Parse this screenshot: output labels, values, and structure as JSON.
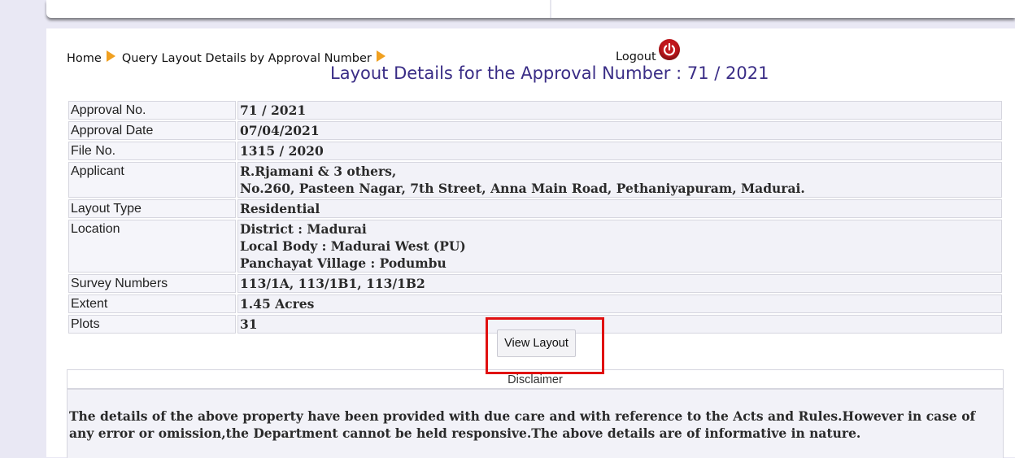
{
  "breadcrumb": {
    "home": "Home",
    "query": "Query Layout Details by Approval Number"
  },
  "logout_label": "Logout",
  "page_title": "Layout Details for the Approval Number : 71 / 2021",
  "details": {
    "approval_no": {
      "label": "Approval No.",
      "value": "71 / 2021"
    },
    "approval_date": {
      "label": "Approval Date",
      "value": "07/04/2021"
    },
    "file_no": {
      "label": "File No.",
      "value": "1315 / 2020"
    },
    "applicant": {
      "label": "Applicant",
      "name": "R.Rjamani & 3 others,",
      "address": "No.260, Pasteen Nagar, 7th Street, Anna Main Road, Pethaniyapuram, Madurai."
    },
    "layout_type": {
      "label": "Layout Type",
      "value": "Residential"
    },
    "location": {
      "label": "Location",
      "district": "District : Madurai",
      "local_body": "Local Body : Madurai West (PU)",
      "village": "Panchayat Village : Podumbu"
    },
    "survey_numbers": {
      "label": "Survey Numbers",
      "value": "113/1A, 113/1B1, 113/1B2"
    },
    "extent": {
      "label": "Extent",
      "value": "1.45 Acres"
    },
    "plots": {
      "label": "Plots",
      "value": "31"
    }
  },
  "view_layout_label": "View Layout",
  "disclaimer": {
    "heading": "Disclaimer",
    "text": "The details of the above property have been provided with due care and with reference to the Acts and Rules.However in case of any error or omission,the Department cannot be held responsive.The above details are of informative in nature."
  },
  "colors": {
    "title": "#3a2d86",
    "arrow": "#f0a020",
    "logout_icon": "#c0161c",
    "highlight": "#e01010",
    "background": "#e9e8f4"
  }
}
